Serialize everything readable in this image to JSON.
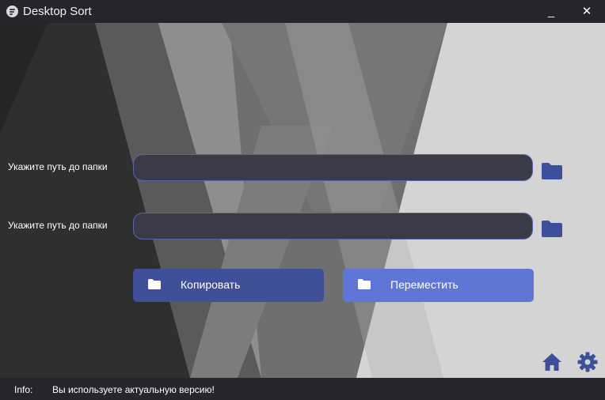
{
  "window": {
    "title": "Desktop Sort",
    "minimize_symbol": "_",
    "close_symbol": "✕"
  },
  "form": {
    "source": {
      "label": "Укажите путь до папки",
      "value": "",
      "browse_icon": "folder-icon"
    },
    "destination": {
      "label": "Укажите путь до папки",
      "value": "",
      "browse_icon": "folder-icon"
    }
  },
  "actions": {
    "copy": {
      "label": "Копировать",
      "icon": "folder-icon",
      "color": "#3f4f98"
    },
    "move": {
      "label": "Переместить",
      "icon": "folder-icon",
      "color": "#5f76d6"
    }
  },
  "corner_icons": {
    "home": "home-icon",
    "settings": "gear-icon"
  },
  "status": {
    "label": "Info:",
    "message": "Вы используете актуальную версию!"
  },
  "colors": {
    "accent_dark": "#3f4f98",
    "accent_light": "#5f76d6",
    "icon_blue": "#3c4f9a",
    "titlebar": "#24252d"
  }
}
